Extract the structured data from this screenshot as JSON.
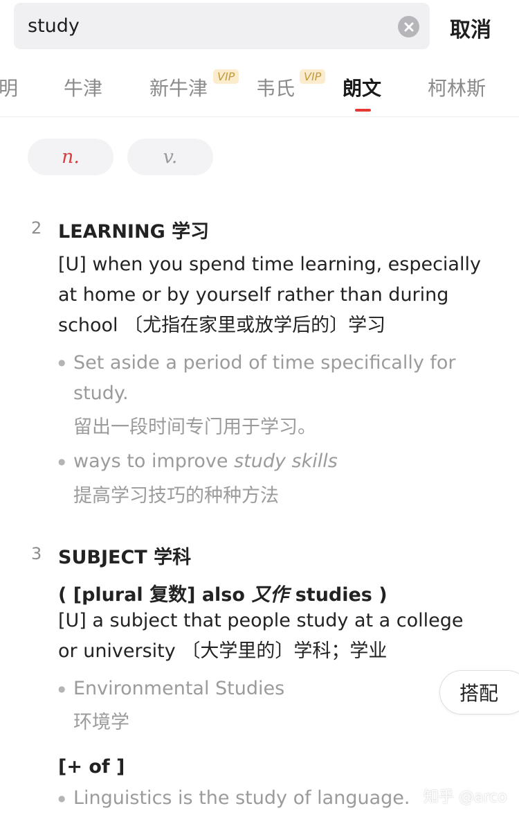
{
  "search": {
    "query": "study",
    "clear_icon": "clear-circle-icon",
    "cancel_label": "取消"
  },
  "tabs": [
    {
      "label": "明",
      "vip": false,
      "active": false
    },
    {
      "label": "牛津",
      "vip": false,
      "active": false
    },
    {
      "label": "新牛津",
      "vip": true,
      "active": false
    },
    {
      "label": "韦氏",
      "vip": true,
      "active": false
    },
    {
      "label": "朗文",
      "vip": false,
      "active": true
    },
    {
      "label": "柯林斯",
      "vip": false,
      "active": false
    }
  ],
  "vip_label": "VIP",
  "accent_color": "#e53935",
  "pos": [
    {
      "label": "n.",
      "active": true
    },
    {
      "label": "v.",
      "active": false
    }
  ],
  "senses": [
    {
      "number": "2",
      "heading": "LEARNING 学习",
      "definition": "[U] when you spend time learning, especially at home or by yourself rather than during school 〔尤指在家里或放学后的〕学习",
      "examples": [
        {
          "en": "Set aside a period of time specifically for study.",
          "zh": "留出一段时间专门用于学习。"
        },
        {
          "en_plain": "ways to improve ",
          "en_italic": "study skills",
          "zh": "提高学习技巧的种种方法"
        }
      ]
    },
    {
      "number": "3",
      "heading": "SUBJECT 学科",
      "grammar_prefix": "( [plural 复数] also ",
      "grammar_italic": "又作",
      "grammar_suffix": " studies )",
      "definition": "[U] a subject that people study at a college or university 〔大学里的〕学科；学业",
      "examples": [
        {
          "en": "Environmental Studies",
          "zh": "环境学"
        }
      ],
      "pattern": "[+ of ]",
      "pattern_examples": [
        {
          "en": "Linguistics is the study of language."
        }
      ]
    }
  ],
  "collocation_label": "搭配",
  "watermark": "知乎 @arco"
}
